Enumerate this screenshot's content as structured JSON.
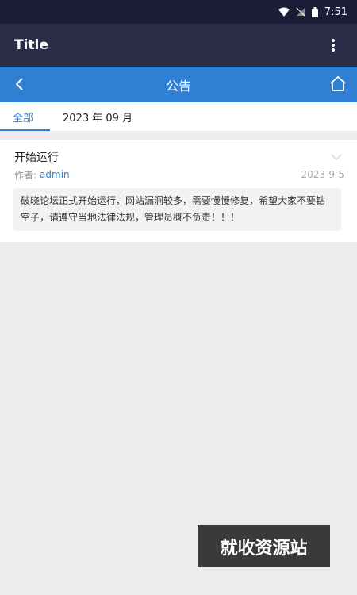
{
  "status_bar": {
    "time": "7:51"
  },
  "app_bar": {
    "title": "Title"
  },
  "nav_bar": {
    "title": "公告"
  },
  "tabs": [
    {
      "label": "全部",
      "active": true
    },
    {
      "label": "2023 年 09 月",
      "active": false
    }
  ],
  "post": {
    "title": "开始运行",
    "author_label": "作者:",
    "author": "admin",
    "date": "2023-9-5",
    "content": "破晓论坛正式开始运行，网站漏洞较多，需要慢慢修复，希望大家不要钻空子，请遵守当地法律法规，管理员概不负责！！！"
  },
  "watermark": {
    "text": "就收资源站"
  },
  "colors": {
    "status_bar": "#1b1d36",
    "app_bar": "#2b2d48",
    "nav_bar": "#2f7fd4",
    "accent": "#2f7fd4"
  }
}
